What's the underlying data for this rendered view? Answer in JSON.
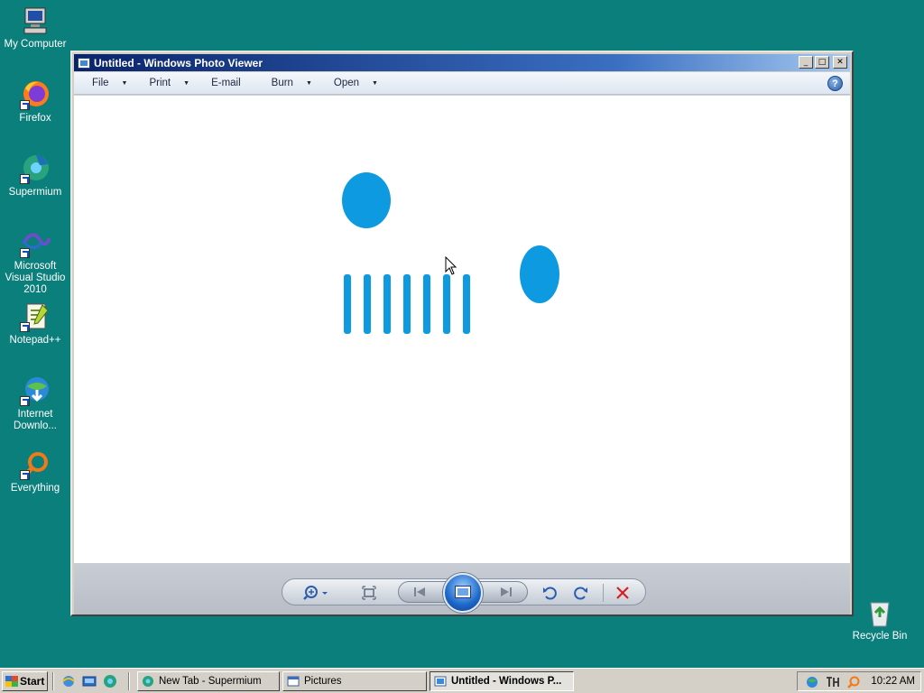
{
  "desktop": {
    "icons": [
      {
        "label": "My Computer",
        "icon": "computer-icon"
      },
      {
        "label": "Firefox",
        "icon": "firefox-icon"
      },
      {
        "label": "Supermium",
        "icon": "supermium-icon"
      },
      {
        "label": "Microsoft Visual Studio 2010",
        "icon": "visual-studio-icon"
      },
      {
        "label": "Notepad++",
        "icon": "notepad-plus-icon"
      },
      {
        "label": "Internet Downlo...",
        "icon": "internet-download-manager-icon"
      },
      {
        "label": "Everything",
        "icon": "everything-search-icon"
      },
      {
        "label": "Recycle Bin",
        "icon": "recycle-bin-icon"
      }
    ]
  },
  "window": {
    "title": "Untitled - Windows Photo Viewer",
    "controls": {
      "minimize": "_",
      "maximize": "□",
      "close": "✕"
    },
    "menu": [
      {
        "label": "File",
        "has_dropdown": true
      },
      {
        "label": "Print",
        "has_dropdown": true
      },
      {
        "label": "E-mail",
        "has_dropdown": false
      },
      {
        "label": "Burn",
        "has_dropdown": true
      },
      {
        "label": "Open",
        "has_dropdown": true
      }
    ],
    "help_label": "?",
    "image": {
      "background": "#ffffff",
      "shape_color": "#0d9ae0",
      "shapes": "two blue ovals and seven vertical blue bars"
    },
    "toolbar": {
      "buttons": [
        "zoom",
        "actual-size",
        "previous",
        "slideshow",
        "next",
        "rotate-counterclockwise",
        "rotate-clockwise",
        "delete"
      ]
    }
  },
  "taskbar": {
    "start_label": "Start",
    "quick_launch": [
      "internet-explorer-icon",
      "show-desktop-icon",
      "supermium-icon"
    ],
    "tasks": [
      {
        "label": "New Tab - Supermium",
        "active": false
      },
      {
        "label": "Pictures",
        "active": false
      },
      {
        "label": "Untitled - Windows P...",
        "active": true
      }
    ],
    "tray_icons": [
      "network-globe-icon",
      "keyboard-icon",
      "everything-tray-icon"
    ],
    "clock": "10:22 AM"
  },
  "colors": {
    "desktop": "#0b7f7b",
    "titlebar_start": "#0a246a",
    "titlebar_end": "#a6caf0",
    "shape_blue": "#0d9ae0",
    "delete_red": "#d42020"
  }
}
